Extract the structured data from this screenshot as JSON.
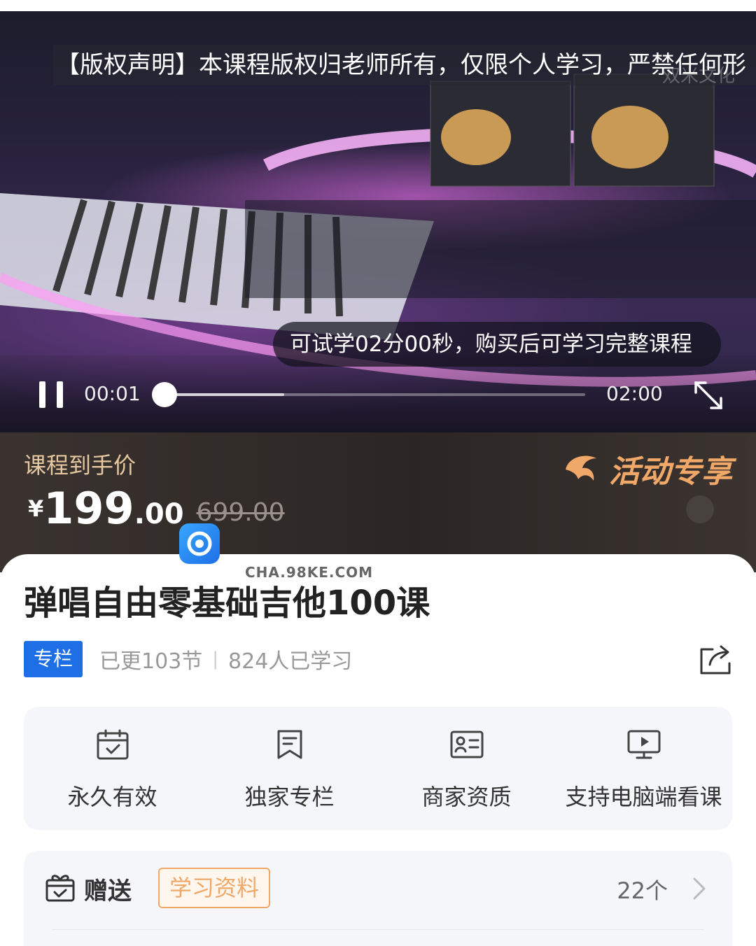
{
  "video": {
    "notice": "【版权声明】本课程版权归老师所有，仅限个人学习，严禁任何形",
    "corner_watermark": "双米文化",
    "trial_tip": "可试学02分00秒，购买后可学习完整课程",
    "current_time": "00:01",
    "total_time": "02:00",
    "progress": 0.0083,
    "buffered": 0.29,
    "icons": {
      "pause": "pause-icon",
      "fullscreen": "fullscreen-icon"
    }
  },
  "price": {
    "label": "课程到手价",
    "currency": "¥",
    "integer": "199",
    "decimal": ".00",
    "original": "699.00",
    "promo_text": "活动专享",
    "colors": {
      "label": "#e6c9a0",
      "promo": "#f0a868"
    }
  },
  "overlay": {
    "site_watermark": "CHA.98KE.COM"
  },
  "course": {
    "title": "弹唱自由零基础吉他100课",
    "tag": "专栏",
    "updated": "已更103节",
    "separator": "|",
    "learners": "824人已学习",
    "accent": "#1e6fe6"
  },
  "features": [
    {
      "label": "永久有效",
      "icon": "calendar-check-icon"
    },
    {
      "label": "独家专栏",
      "icon": "bookmark-icon"
    },
    {
      "label": "商家资质",
      "icon": "id-card-icon"
    },
    {
      "label": "支持电脑端看课",
      "icon": "monitor-play-icon"
    }
  ],
  "gift": {
    "label": "赠送",
    "tag": "学习资料",
    "count": "22个",
    "icon": "gift-box-icon"
  }
}
